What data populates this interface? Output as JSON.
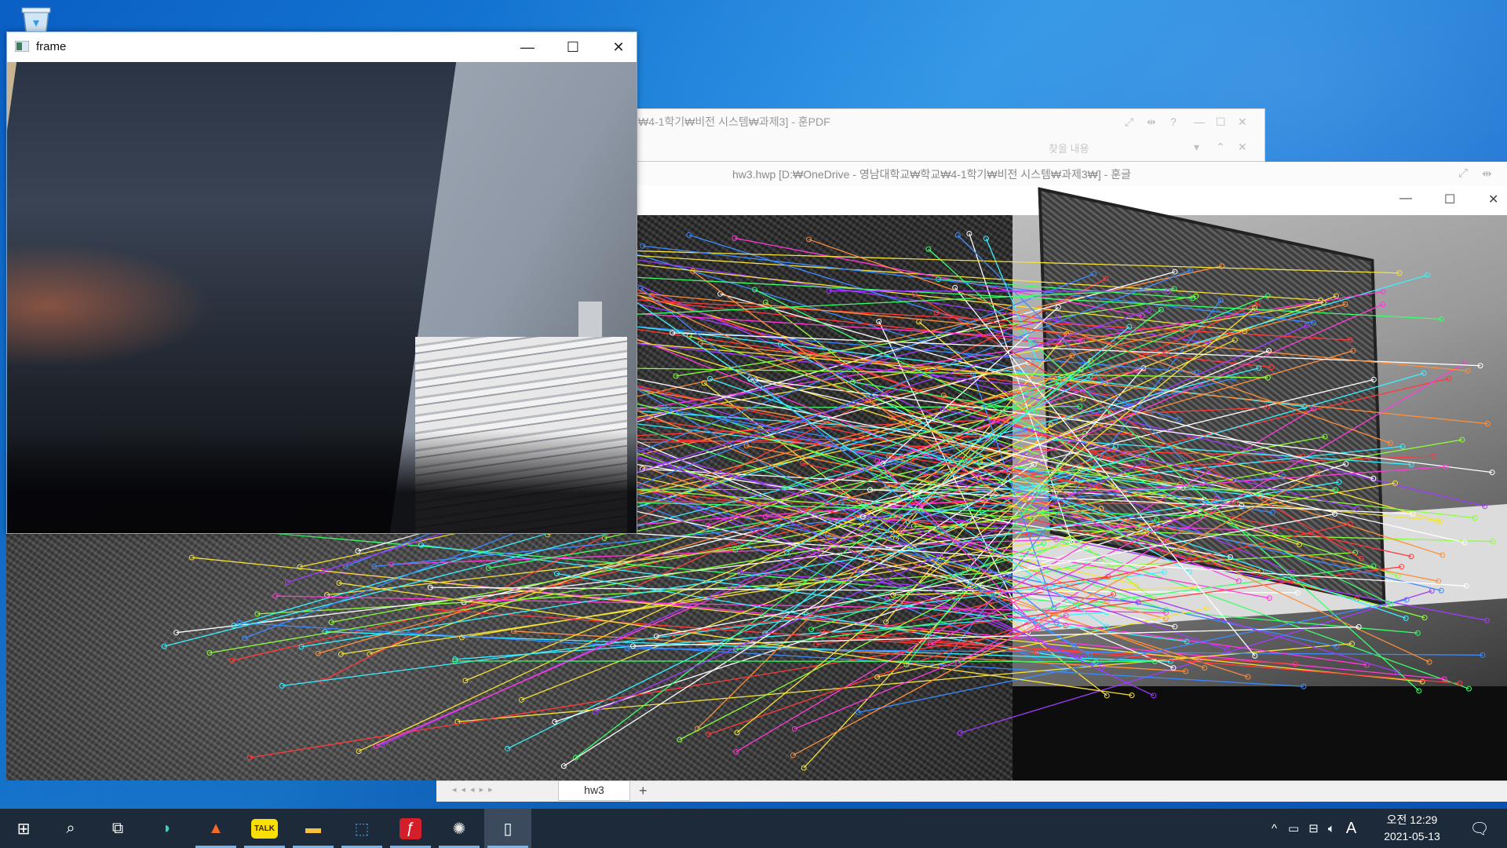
{
  "desktop": {
    "recycle_bin_icon": "recycle-bin-icon"
  },
  "pdf_window": {
    "title": "₩4-1학기₩비전 시스템₩과제3] - 훈PDF",
    "search_placeholder": "찾을 내용"
  },
  "hwp_window": {
    "title": "hw3.hwp [D:₩OneDrive - 영남대학교₩학교₩4-1학기₩비전 시스템₩과제3₩] - 훈글",
    "tab_label": "hw3",
    "add_tab": "+"
  },
  "match_window": {
    "minimize": "—",
    "maximize": "☐",
    "close": "✕"
  },
  "frame_window": {
    "title": "frame",
    "minimize": "—",
    "maximize": "☐",
    "close": "✕"
  },
  "taskbar": {
    "apps": [
      {
        "name": "start-button",
        "icon": "windows-icon",
        "glyph": "⊞"
      },
      {
        "name": "search-button",
        "icon": "search-icon",
        "glyph": "⌕"
      },
      {
        "name": "task-view-button",
        "icon": "task-view-icon",
        "glyph": "⧉"
      },
      {
        "name": "app-whale",
        "icon": "whale-icon",
        "glyph": "◗"
      },
      {
        "name": "app-matlab",
        "icon": "matlab-icon",
        "glyph": "▲"
      },
      {
        "name": "app-kakaotalk",
        "icon": "kakaotalk-icon",
        "glyph": "TALK"
      },
      {
        "name": "app-file-explorer",
        "icon": "folder-icon",
        "glyph": "▬"
      },
      {
        "name": "app-hwp-viewer",
        "icon": "hwp-icon",
        "glyph": "⬚"
      },
      {
        "name": "app-hoonpdf",
        "icon": "pdf-icon",
        "glyph": "ƒ"
      },
      {
        "name": "app-settings-web",
        "icon": "spider-icon",
        "glyph": "✺"
      },
      {
        "name": "app-document",
        "icon": "document-icon",
        "glyph": "▯"
      }
    ],
    "tray": {
      "chevron": "^",
      "ime": "A",
      "time": "오전 12:29",
      "date": "2021-05-13",
      "notifications_icon": "notification-icon"
    }
  },
  "colors": {
    "desktop_blue": "#0a66c9",
    "taskbar": "#1c2a3a",
    "line_colors": [
      "#ff3b3b",
      "#3bff6b",
      "#3b8bff",
      "#ff3bd8",
      "#f5e23b",
      "#3bf0ff",
      "#a03bff",
      "#ff8f3b",
      "#8bff3b",
      "#ffffff"
    ]
  }
}
